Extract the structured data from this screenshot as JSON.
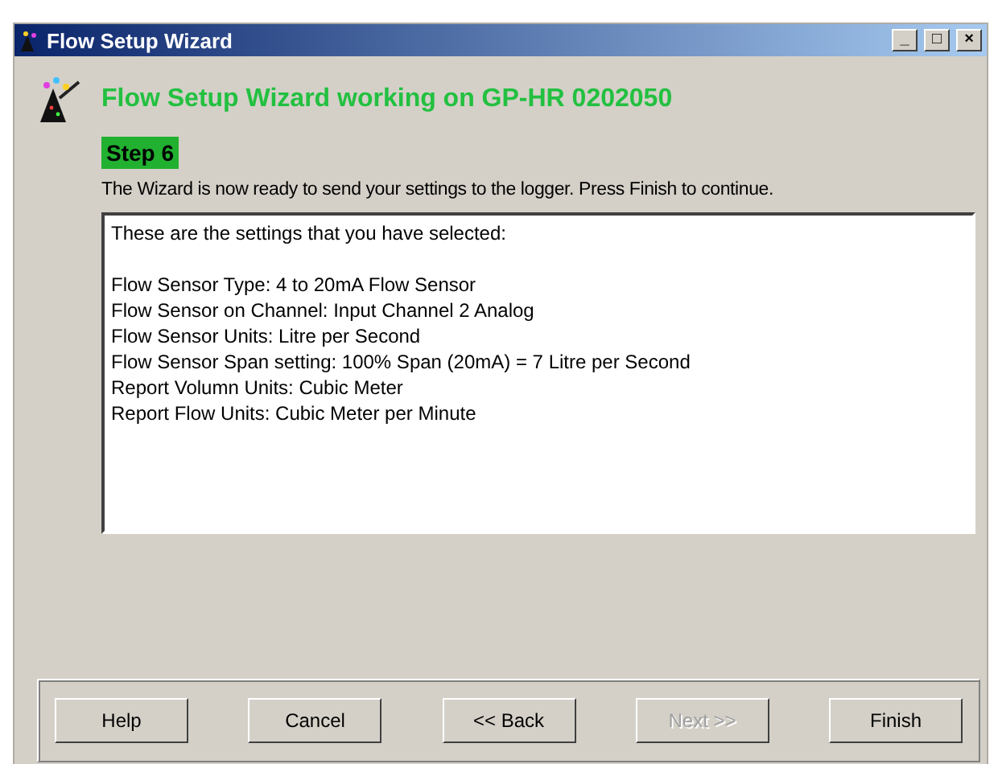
{
  "window": {
    "title": "Flow Setup Wizard",
    "controls": [
      "_",
      "□",
      "×"
    ]
  },
  "heading": "Flow Setup Wizard working on GP-HR 0202050",
  "step": "Step 6",
  "instruction": "The Wizard is now ready to send your settings to the logger. Press Finish to continue.",
  "summary": {
    "intro": "These are the settings that you have selected:",
    "lines": [
      "Flow Sensor Type: 4 to 20mA Flow Sensor",
      "Flow Sensor on Channel: Input Channel 2 Analog",
      "Flow Sensor Units: Litre per Second",
      "Flow Sensor Span setting: 100% Span (20mA) = 7 Litre per Second",
      "Report Volumn Units: Cubic Meter",
      "Report Flow Units: Cubic Meter per Minute"
    ]
  },
  "buttons": [
    {
      "label": "Help",
      "disabled": false
    },
    {
      "label": "Cancel",
      "disabled": false
    },
    {
      "label": "<< Back",
      "disabled": false
    },
    {
      "label": "Next >>",
      "disabled": true
    },
    {
      "label": "Finish",
      "disabled": false
    }
  ]
}
